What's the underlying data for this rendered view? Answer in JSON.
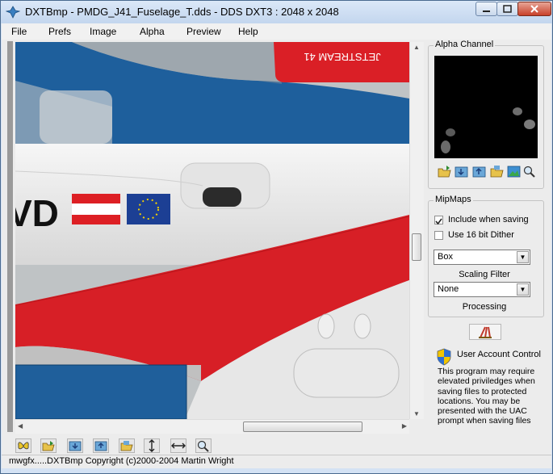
{
  "window": {
    "title": "DXTBmp - PMDG_J41_Fuselage_T.dds - DDS DXT3 : 2048 x 2048",
    "controls": [
      "minimize",
      "maximize",
      "close"
    ]
  },
  "menu": [
    "File",
    "Prefs",
    "Image",
    "Alpha",
    "Preview",
    "Help"
  ],
  "canvas": {
    "texture_text": "JETSTREAM 41",
    "registration_text": "VD"
  },
  "toolbar_icons": [
    "butterfly-icon",
    "open-folder-icon",
    "import-icon",
    "export-icon",
    "open-image-folder-icon",
    "flip-vertical-icon",
    "flip-horizontal-icon",
    "zoom-icon"
  ],
  "alpha_panel": {
    "title": "Alpha Channel",
    "icons": [
      "open-folder-icon",
      "import-icon",
      "export-icon",
      "open-image-folder-icon",
      "image-icon",
      "zoom-icon"
    ]
  },
  "mipmaps": {
    "title": "MipMaps",
    "include_label": "Include when saving",
    "include_checked": true,
    "dither_label": "Use 16 bit Dither",
    "dither_checked": false,
    "scaling_value": "Box",
    "scaling_caption": "Scaling Filter",
    "processing_value": "None",
    "processing_caption": "Processing"
  },
  "uac": {
    "title": "User Account Control",
    "text": "This program may require elevated priviledges when saving files to protected locations. You may be presented with the UAC prompt when saving files"
  },
  "status": "mwgfx.....DXTBmp Copyright (c)2000-2004 Martin Wright",
  "colors": {
    "accent": "#dd1f24",
    "blue": "#1d64a4",
    "eu": "#1c3f94"
  }
}
